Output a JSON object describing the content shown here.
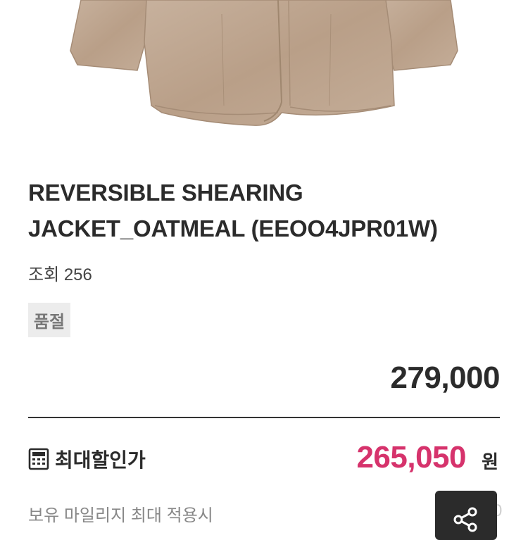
{
  "product": {
    "title_line1": "REVERSIBLE SHEARING",
    "title_line2": "JACKET_OATMEAL (EEOO4JPR01W)",
    "views": "조회 256",
    "badge": "품절",
    "price": "279,000"
  },
  "discount": {
    "label": "최대할인가",
    "price": "265,050",
    "currency": "원",
    "note": "보유 마일리지 최대 적용시",
    "note_trail": "0"
  },
  "image": {
    "description_icon": "jacket-image",
    "color": "#bda58f"
  },
  "accent_color": "#d6336c"
}
